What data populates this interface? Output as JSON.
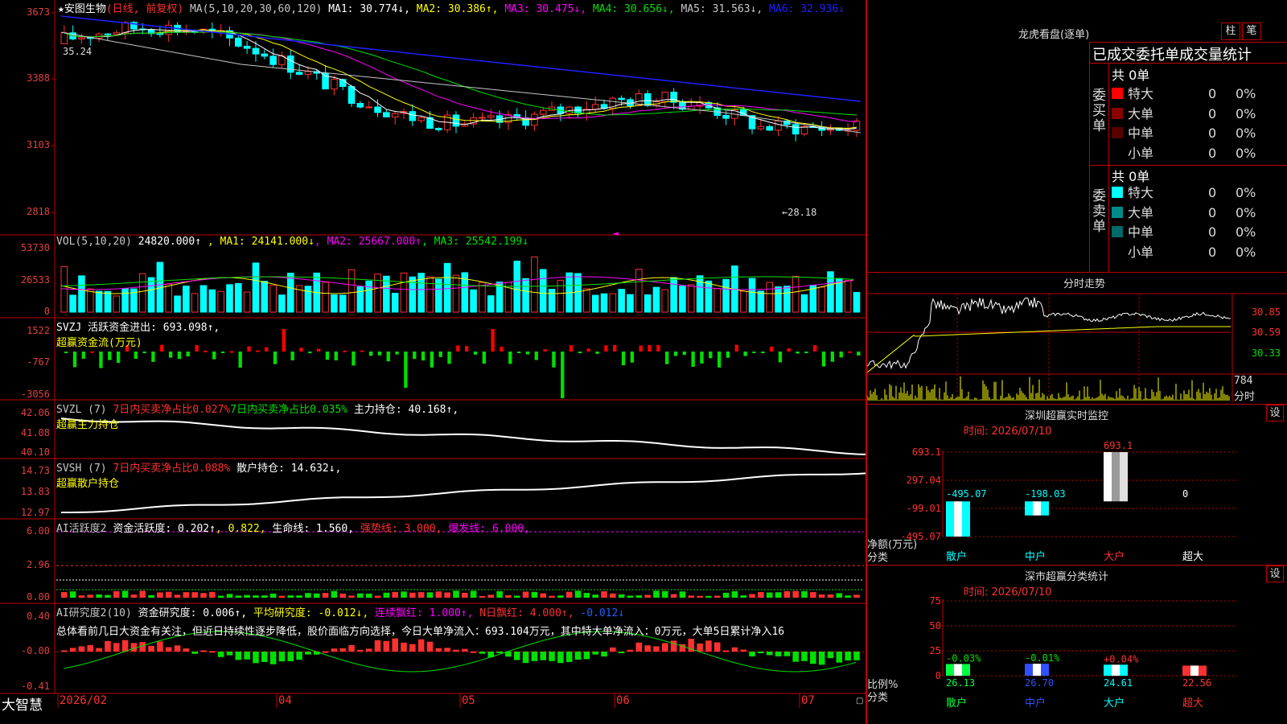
{
  "app": {
    "brand": "大智慧"
  },
  "kline": {
    "stock": "安图生物",
    "period": "(日线, 前复权)",
    "ma_label": "MA(5,10,20,30,60,120)",
    "mas": [
      {
        "name": "MA1",
        "value": "30.774",
        "arrow": "↓",
        "color": "#ffffff"
      },
      {
        "name": "MA2",
        "value": "30.386",
        "arrow": "↑",
        "color": "#ffff00"
      },
      {
        "name": "MA3",
        "value": "30.475",
        "arrow": "↓",
        "color": "#ff00ff"
      },
      {
        "name": "MA4",
        "value": "30.656",
        "arrow": "↓",
        "color": "#00e000"
      },
      {
        "name": "MA5",
        "value": "31.563",
        "arrow": "↓",
        "color": "#c8c8c8"
      },
      {
        "name": "MA6",
        "value": "32.936",
        "arrow": "↓",
        "color": "#2020ff"
      }
    ],
    "yticks": [
      "3673",
      "3388",
      "3103",
      "2818"
    ],
    "high_label": "35.24",
    "low_label": "←28.18"
  },
  "vol": {
    "label": "VOL(5,10,20)",
    "value": "24820.000↑",
    "mas": [
      {
        "text": "MA1: 24141.000↓",
        "color": "#ffff00"
      },
      {
        "text": "MA2: 25667.000↑",
        "color": "#ff00ff"
      },
      {
        "text": "MA3: 25542.199↓",
        "color": "#00e000"
      }
    ],
    "yticks": [
      "53730",
      "26533",
      "0"
    ]
  },
  "svzj": {
    "line1": "SVZJ  活跃资金进出: 693.098↑,",
    "line2": "超赢资金流(万元)",
    "yticks": [
      "1522",
      "-767",
      "-3056"
    ]
  },
  "svzl": {
    "parts": [
      {
        "text": "SVZL (7) ",
        "color": "#c8c8c8"
      },
      {
        "text": "7日内买卖净占比0.027%",
        "color": "#ff3030"
      },
      {
        "text": "7日内买卖净占比0.035%",
        "color": "#00e000"
      },
      {
        "text": " 主力持仓: 40.168↑,",
        "color": "#ffffff"
      }
    ],
    "line2": "超赢主力持仓",
    "yticks": [
      "42.06",
      "41.08",
      "40.10"
    ]
  },
  "svsh": {
    "parts": [
      {
        "text": "SVSH (7) ",
        "color": "#c8c8c8"
      },
      {
        "text": "7日内买卖净占比0.088%",
        "color": "#ff3030"
      },
      {
        "text": " 散户持仓: 14.632↓,",
        "color": "#ffffff"
      }
    ],
    "line2": "超赢散户持仓",
    "yticks": [
      "14.73",
      "13.83",
      "12.97"
    ]
  },
  "ai_active": {
    "parts": [
      {
        "text": "AI活跃度2 ",
        "color": "#c8c8c8"
      },
      {
        "text": "资金活跃度: 0.202↑",
        "color": "#ffffff"
      },
      {
        "text": ", 0.822, ",
        "color": "#ffff00"
      },
      {
        "text": "生命线: 1.560, ",
        "color": "#ffffff"
      },
      {
        "text": "强势线: 3.000, ",
        "color": "#ff3030"
      },
      {
        "text": "爆发线: 6.000,",
        "color": "#ff00ff"
      }
    ],
    "yticks": [
      "6.00",
      "2.96",
      "0.00"
    ]
  },
  "ai_research": {
    "parts": [
      {
        "text": "AI研究度2(10) ",
        "color": "#c8c8c8"
      },
      {
        "text": "资金研究度: 0.006↑, ",
        "color": "#ffffff"
      },
      {
        "text": "平均研究度: -0.012↓, ",
        "color": "#ffff00"
      },
      {
        "text": "连续飘红: 1.000↑, ",
        "color": "#ff00ff"
      },
      {
        "text": "N日飘红: 4.000↑, ",
        "color": "#ff3030"
      },
      {
        "text": "-0.012↓",
        "color": "#2060ff"
      }
    ],
    "summary": "总体看前几日大资金有关注，但近日持续性逐步降低，股价面临方向选择，今日大单净流入：693.104万元，其中特大单净流入：0万元，大单5日累计净入16",
    "yticks": [
      "0.40",
      "-0.00",
      "-0.41"
    ]
  },
  "xaxis": {
    "labels": [
      "2026/02",
      "04",
      "05",
      "06",
      "07"
    ]
  },
  "longhu": {
    "title": "龙虎看盘(逐单)",
    "btn_bar": "柱",
    "btn_pen": "笔",
    "header": "已成交委托单成交量统计",
    "buy": {
      "side": "委买单",
      "total": "共 0单",
      "rows": [
        {
          "label": "特大",
          "v1": "0",
          "v2": "0%",
          "color": "#ff0000"
        },
        {
          "label": "大单",
          "v1": "0",
          "v2": "0%",
          "color": "#8b0000"
        },
        {
          "label": "中单",
          "v1": "0",
          "v2": "0%",
          "color": "#5a0000"
        },
        {
          "label": "小单",
          "v1": "0",
          "v2": "0%",
          "color": ""
        }
      ]
    },
    "sell": {
      "side": "委卖单",
      "total": "共 0单",
      "rows": [
        {
          "label": "特大",
          "v1": "0",
          "v2": "0%",
          "color": "#00ffff"
        },
        {
          "label": "大单",
          "v1": "0",
          "v2": "0%",
          "color": "#008b8b"
        },
        {
          "label": "中单",
          "v1": "0",
          "v2": "0%",
          "color": "#006a6a"
        },
        {
          "label": "小单",
          "v1": "0",
          "v2": "0%",
          "color": ""
        }
      ]
    }
  },
  "intraday": {
    "title": "分时走势",
    "yticks": [
      "30.85",
      "30.59",
      "30.33"
    ],
    "vol_ticks": [
      "784",
      "分时"
    ]
  },
  "sz_monitor": {
    "title": "深圳超赢实时监控",
    "btn": "设",
    "time": "时间: 2026/07/10",
    "yticks": [
      "693.1",
      "297.04",
      "-99.01",
      "-495.07"
    ],
    "ylabel_1": "净额(万元)",
    "ylabel_2": "分类",
    "bars": [
      {
        "cat": "散户",
        "label": "-495.07",
        "value": -495.07
      },
      {
        "cat": "中户",
        "label": "-198.03",
        "value": -198.03
      },
      {
        "cat": "大户",
        "label": "693.1",
        "value": 693.1
      },
      {
        "cat": "超大",
        "label": "0",
        "value": 0
      }
    ]
  },
  "sz_class": {
    "title": "深市超赢分类统计",
    "btn": "设",
    "time": "时间: 2026/07/10",
    "yticks": [
      "75",
      "50",
      "25",
      "0"
    ],
    "ylabel_1": "比例%",
    "ylabel_2": "分类",
    "bars": [
      {
        "cat": "散户",
        "value": 26.13,
        "val_label": "26.13",
        "chg": "-0.03%",
        "color": "#00ff40"
      },
      {
        "cat": "中户",
        "value": 26.7,
        "val_label": "26.70",
        "chg": "-0.01%",
        "color": "#3050ff"
      },
      {
        "cat": "大户",
        "value": 24.61,
        "val_label": "24.61",
        "chg": "+0.04%",
        "color": "#00ffff"
      },
      {
        "cat": "超大",
        "value": 22.56,
        "val_label": "22.56",
        "chg": "",
        "color": "#ff3030"
      }
    ]
  }
}
